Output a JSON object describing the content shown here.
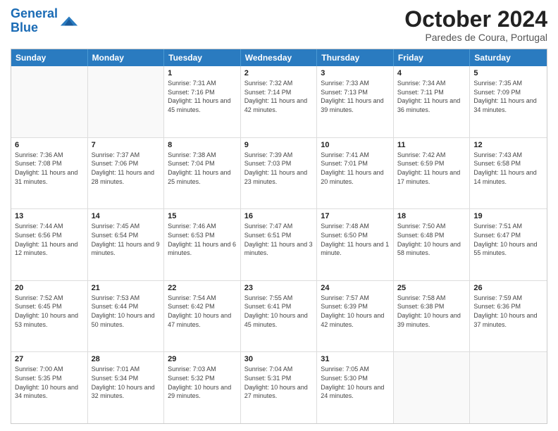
{
  "header": {
    "logo_line1": "General",
    "logo_line2": "Blue",
    "month": "October 2024",
    "location": "Paredes de Coura, Portugal"
  },
  "weekdays": [
    "Sunday",
    "Monday",
    "Tuesday",
    "Wednesday",
    "Thursday",
    "Friday",
    "Saturday"
  ],
  "rows": [
    [
      {
        "date": "",
        "info": ""
      },
      {
        "date": "",
        "info": ""
      },
      {
        "date": "1",
        "info": "Sunrise: 7:31 AM\nSunset: 7:16 PM\nDaylight: 11 hours and 45 minutes."
      },
      {
        "date": "2",
        "info": "Sunrise: 7:32 AM\nSunset: 7:14 PM\nDaylight: 11 hours and 42 minutes."
      },
      {
        "date": "3",
        "info": "Sunrise: 7:33 AM\nSunset: 7:13 PM\nDaylight: 11 hours and 39 minutes."
      },
      {
        "date": "4",
        "info": "Sunrise: 7:34 AM\nSunset: 7:11 PM\nDaylight: 11 hours and 36 minutes."
      },
      {
        "date": "5",
        "info": "Sunrise: 7:35 AM\nSunset: 7:09 PM\nDaylight: 11 hours and 34 minutes."
      }
    ],
    [
      {
        "date": "6",
        "info": "Sunrise: 7:36 AM\nSunset: 7:08 PM\nDaylight: 11 hours and 31 minutes."
      },
      {
        "date": "7",
        "info": "Sunrise: 7:37 AM\nSunset: 7:06 PM\nDaylight: 11 hours and 28 minutes."
      },
      {
        "date": "8",
        "info": "Sunrise: 7:38 AM\nSunset: 7:04 PM\nDaylight: 11 hours and 25 minutes."
      },
      {
        "date": "9",
        "info": "Sunrise: 7:39 AM\nSunset: 7:03 PM\nDaylight: 11 hours and 23 minutes."
      },
      {
        "date": "10",
        "info": "Sunrise: 7:41 AM\nSunset: 7:01 PM\nDaylight: 11 hours and 20 minutes."
      },
      {
        "date": "11",
        "info": "Sunrise: 7:42 AM\nSunset: 6:59 PM\nDaylight: 11 hours and 17 minutes."
      },
      {
        "date": "12",
        "info": "Sunrise: 7:43 AM\nSunset: 6:58 PM\nDaylight: 11 hours and 14 minutes."
      }
    ],
    [
      {
        "date": "13",
        "info": "Sunrise: 7:44 AM\nSunset: 6:56 PM\nDaylight: 11 hours and 12 minutes."
      },
      {
        "date": "14",
        "info": "Sunrise: 7:45 AM\nSunset: 6:54 PM\nDaylight: 11 hours and 9 minutes."
      },
      {
        "date": "15",
        "info": "Sunrise: 7:46 AM\nSunset: 6:53 PM\nDaylight: 11 hours and 6 minutes."
      },
      {
        "date": "16",
        "info": "Sunrise: 7:47 AM\nSunset: 6:51 PM\nDaylight: 11 hours and 3 minutes."
      },
      {
        "date": "17",
        "info": "Sunrise: 7:48 AM\nSunset: 6:50 PM\nDaylight: 11 hours and 1 minute."
      },
      {
        "date": "18",
        "info": "Sunrise: 7:50 AM\nSunset: 6:48 PM\nDaylight: 10 hours and 58 minutes."
      },
      {
        "date": "19",
        "info": "Sunrise: 7:51 AM\nSunset: 6:47 PM\nDaylight: 10 hours and 55 minutes."
      }
    ],
    [
      {
        "date": "20",
        "info": "Sunrise: 7:52 AM\nSunset: 6:45 PM\nDaylight: 10 hours and 53 minutes."
      },
      {
        "date": "21",
        "info": "Sunrise: 7:53 AM\nSunset: 6:44 PM\nDaylight: 10 hours and 50 minutes."
      },
      {
        "date": "22",
        "info": "Sunrise: 7:54 AM\nSunset: 6:42 PM\nDaylight: 10 hours and 47 minutes."
      },
      {
        "date": "23",
        "info": "Sunrise: 7:55 AM\nSunset: 6:41 PM\nDaylight: 10 hours and 45 minutes."
      },
      {
        "date": "24",
        "info": "Sunrise: 7:57 AM\nSunset: 6:39 PM\nDaylight: 10 hours and 42 minutes."
      },
      {
        "date": "25",
        "info": "Sunrise: 7:58 AM\nSunset: 6:38 PM\nDaylight: 10 hours and 39 minutes."
      },
      {
        "date": "26",
        "info": "Sunrise: 7:59 AM\nSunset: 6:36 PM\nDaylight: 10 hours and 37 minutes."
      }
    ],
    [
      {
        "date": "27",
        "info": "Sunrise: 7:00 AM\nSunset: 5:35 PM\nDaylight: 10 hours and 34 minutes."
      },
      {
        "date": "28",
        "info": "Sunrise: 7:01 AM\nSunset: 5:34 PM\nDaylight: 10 hours and 32 minutes."
      },
      {
        "date": "29",
        "info": "Sunrise: 7:03 AM\nSunset: 5:32 PM\nDaylight: 10 hours and 29 minutes."
      },
      {
        "date": "30",
        "info": "Sunrise: 7:04 AM\nSunset: 5:31 PM\nDaylight: 10 hours and 27 minutes."
      },
      {
        "date": "31",
        "info": "Sunrise: 7:05 AM\nSunset: 5:30 PM\nDaylight: 10 hours and 24 minutes."
      },
      {
        "date": "",
        "info": ""
      },
      {
        "date": "",
        "info": ""
      }
    ]
  ]
}
